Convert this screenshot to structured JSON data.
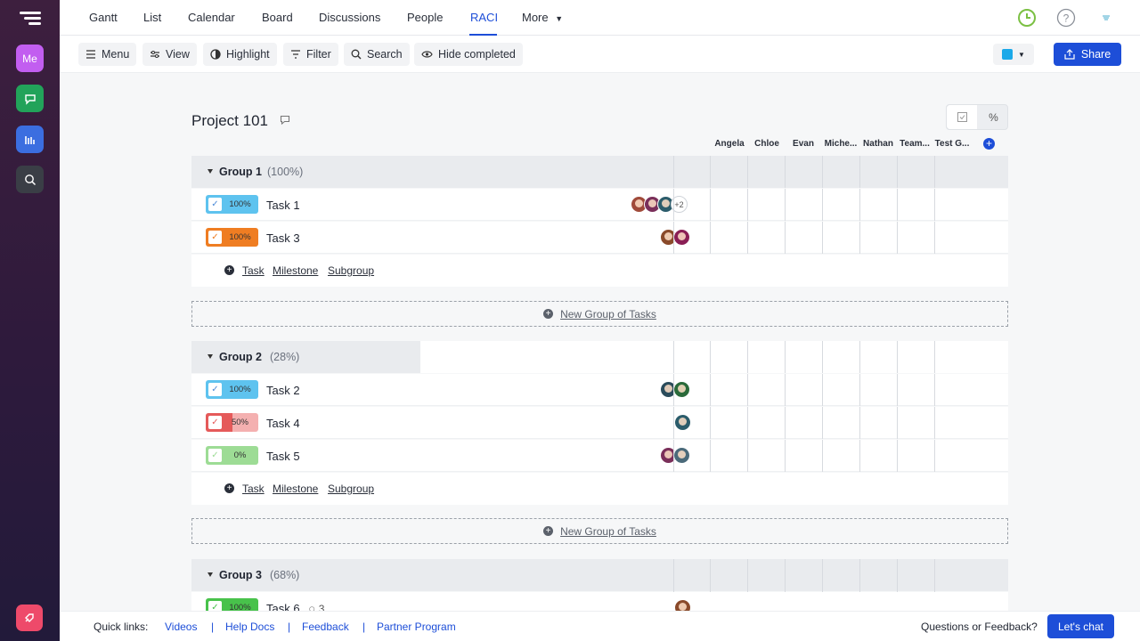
{
  "sidebar": {
    "items": [
      {
        "label": "Me",
        "color": "#c25ef0"
      },
      {
        "icon": "chat-icon",
        "color": "#22a35a"
      },
      {
        "icon": "chart-icon",
        "color": "#3b6ee0"
      },
      {
        "icon": "search-icon",
        "color": "#3a3e46"
      },
      {
        "icon": "rocket-icon",
        "color": "#ee4a6a"
      }
    ]
  },
  "nav": {
    "tabs": [
      "Gantt",
      "List",
      "Calendar",
      "Board",
      "Discussions",
      "People",
      "RACI",
      "More"
    ],
    "active": "RACI"
  },
  "toolbar": {
    "menu": "Menu",
    "view": "View",
    "highlight": "Highlight",
    "filter": "Filter",
    "search": "Search",
    "hide_completed": "Hide completed",
    "share": "Share",
    "color_swatch": "#1ba9e9"
  },
  "project": {
    "title": "Project 101",
    "raci_people": [
      "Angela",
      "Chloe",
      "Evan",
      "Miche...",
      "Nathan",
      "Team...",
      "Test G..."
    ],
    "add_task": "Task",
    "add_milestone": "Milestone",
    "add_subgroup": "Subgroup",
    "new_group": "New Group of Tasks",
    "groups": [
      {
        "name": "Group 1",
        "pct": "(100%)",
        "tasks": [
          {
            "name": "Task 1",
            "progress": "100%",
            "color": "#5ec3ef",
            "more": "+2"
          },
          {
            "name": "Task 3",
            "progress": "100%",
            "color": "#ef7d22"
          }
        ]
      },
      {
        "name": "Group 2",
        "pct": "(28%)",
        "tasks": [
          {
            "name": "Task 2",
            "progress": "100%",
            "color": "#5ec3ef"
          },
          {
            "name": "Task 4",
            "progress": "50%",
            "color": "#e55a5a"
          },
          {
            "name": "Task 5",
            "progress": "0%",
            "color": "#7cd07a"
          }
        ]
      },
      {
        "name": "Group 3",
        "pct": "(68%)",
        "tasks": [
          {
            "name": "Task 6",
            "progress": "100%",
            "color": "#48c24b",
            "comments": "3"
          }
        ]
      }
    ]
  },
  "footer": {
    "quick_links": "Quick links:",
    "videos": "Videos",
    "help_docs": "Help Docs",
    "feedback": "Feedback",
    "partner": "Partner Program",
    "questions": "Questions or Feedback?",
    "chat": "Let's chat"
  }
}
